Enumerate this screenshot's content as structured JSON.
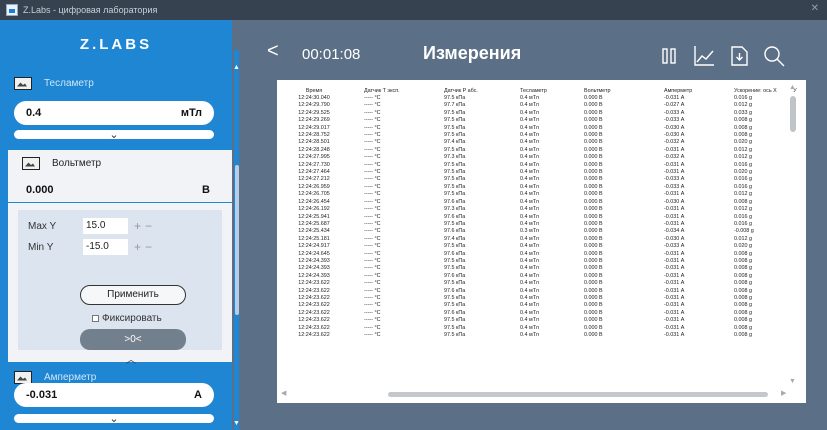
{
  "window": {
    "title": "Z.Labs - цифровая лаборатория"
  },
  "sidebar": {
    "logo": "Z.LABS",
    "teslameter": {
      "name": "Тесламетр",
      "value": "0.4",
      "unit": "мТл"
    },
    "voltmeter": {
      "name": "Вольтметр",
      "value": "0.000",
      "unit": "В",
      "max_y_label": "Max Y",
      "max_y_value": "15.0",
      "min_y_label": "Min Y",
      "min_y_value": "-15.0",
      "apply_label": "Применить",
      "fix_label": "Фиксировать",
      "zero_label": ">0<"
    },
    "ammeter": {
      "name": "Амперметр",
      "value": "-0.031",
      "unit": "А"
    }
  },
  "header": {
    "back_glyph": "<",
    "timer": "00:01:08",
    "title": "Измерения"
  },
  "table": {
    "columns": [
      "Время",
      "Датчик T эксп.",
      "Датчик P абс.",
      "Тесламетр",
      "Вольтметр",
      "Амперметр",
      "Ускорение: ось X",
      "У"
    ],
    "rows": [
      [
        "12:24:30.040",
        "----- °C",
        "97.5 кПа",
        "0.4 мТл",
        "0.000 В",
        "-0.031 А",
        "0.016 g",
        ""
      ],
      [
        "12:24:29.790",
        "----- °C",
        "97.7 кПа",
        "0.4 мТл",
        "0.000 В",
        "-0.027 А",
        "0.012 g",
        ""
      ],
      [
        "12:24:29.525",
        "----- °C",
        "97.5 кПа",
        "0.4 мТл",
        "0.000 В",
        "-0.033 А",
        "0.033 g",
        ""
      ],
      [
        "12:24:29.269",
        "----- °C",
        "97.5 кПа",
        "0.4 мТл",
        "0.000 В",
        "-0.033 А",
        "0.008 g",
        ""
      ],
      [
        "12:24:29.017",
        "----- °C",
        "97.5 кПа",
        "0.4 мТл",
        "0.000 В",
        "-0.030 А",
        "0.008 g",
        ""
      ],
      [
        "12:24:28.752",
        "----- °C",
        "97.5 кПа",
        "0.4 мТл",
        "0.000 В",
        "-0.030 А",
        "0.008 g",
        ""
      ],
      [
        "12:24:28.501",
        "----- °C",
        "97.4 кПа",
        "0.4 мТл",
        "0.000 В",
        "-0.032 А",
        "0.020 g",
        ""
      ],
      [
        "12:24:28.248",
        "----- °C",
        "97.5 кПа",
        "0.4 мТл",
        "0.000 В",
        "-0.031 А",
        "0.012 g",
        ""
      ],
      [
        "12:24:27.995",
        "----- °C",
        "97.3 кПа",
        "0.4 мТл",
        "0.000 В",
        "-0.032 А",
        "0.012 g",
        ""
      ],
      [
        "12:24:27.730",
        "----- °C",
        "97.5 кПа",
        "0.4 мТл",
        "0.000 В",
        "-0.031 А",
        "0.016 g",
        ""
      ],
      [
        "12:24:27.464",
        "----- °C",
        "97.5 кПа",
        "0.4 мТл",
        "0.000 В",
        "-0.031 А",
        "0.020 g",
        ""
      ],
      [
        "12:24:27.212",
        "----- °C",
        "97.5 кПа",
        "0.4 мТл",
        "0.000 В",
        "-0.033 А",
        "0.016 g",
        ""
      ],
      [
        "12:24:26.959",
        "----- °C",
        "97.5 кПа",
        "0.4 мТл",
        "0.000 В",
        "-0.033 А",
        "0.016 g",
        ""
      ],
      [
        "12:24:26.705",
        "----- °C",
        "97.5 кПа",
        "0.4 мТл",
        "0.000 В",
        "-0.031 А",
        "0.012 g",
        ""
      ],
      [
        "12:24:26.454",
        "----- °C",
        "97.6 кПа",
        "0.4 мТл",
        "0.000 В",
        "-0.030 А",
        "0.008 g",
        ""
      ],
      [
        "12:24:26.192",
        "----- °C",
        "97.3 кПа",
        "0.4 мТл",
        "0.000 В",
        "-0.031 А",
        "0.012 g",
        ""
      ],
      [
        "12:24:25.941",
        "----- °C",
        "97.6 кПа",
        "0.4 мТл",
        "0.000 В",
        "-0.031 А",
        "0.016 g",
        ""
      ],
      [
        "12:24:25.687",
        "----- °C",
        "97.5 кПа",
        "0.4 мТл",
        "0.000 В",
        "-0.031 А",
        "0.016 g",
        ""
      ],
      [
        "12:24:25.434",
        "----- °C",
        "97.6 кПа",
        "0.3 мТл",
        "0.000 В",
        "-0.034 А",
        "-0.008 g",
        ""
      ],
      [
        "12:24:25.181",
        "----- °C",
        "97.4 кПа",
        "0.4 мТл",
        "0.000 В",
        "-0.030 А",
        "0.012 g",
        ""
      ],
      [
        "12:24:24.917",
        "----- °C",
        "97.5 кПа",
        "0.4 мТл",
        "0.000 В",
        "-0.033 А",
        "0.020 g",
        ""
      ],
      [
        "12:24:24.645",
        "----- °C",
        "97.6 кПа",
        "0.4 мТл",
        "0.000 В",
        "-0.031 А",
        "0.008 g",
        ""
      ],
      [
        "12:24:24.393",
        "----- °C",
        "97.5 кПа",
        "0.4 мТл",
        "0.000 В",
        "-0.031 А",
        "0.008 g",
        ""
      ],
      [
        "12:24:24.393",
        "----- °C",
        "97.5 кПа",
        "0.4 мТл",
        "0.000 В",
        "-0.031 А",
        "0.008 g",
        ""
      ],
      [
        "12:24:24.393",
        "----- °C",
        "97.6 кПа",
        "0.4 мТл",
        "0.000 В",
        "-0.031 А",
        "0.008 g",
        ""
      ],
      [
        "12:24:23.622",
        "----- °C",
        "97.5 кПа",
        "0.4 мТл",
        "0.000 В",
        "-0.031 А",
        "0.008 g",
        ""
      ],
      [
        "12:24:23.622",
        "----- °C",
        "97.6 кПа",
        "0.4 мТл",
        "0.000 В",
        "-0.031 А",
        "0.008 g",
        ""
      ],
      [
        "12:24:23.622",
        "----- °C",
        "97.5 кПа",
        "0.4 мТл",
        "0.000 В",
        "-0.031 А",
        "0.008 g",
        ""
      ],
      [
        "12:24:23.622",
        "----- °C",
        "97.5 кПа",
        "0.4 мТл",
        "0.000 В",
        "-0.031 А",
        "0.008 g",
        ""
      ],
      [
        "12:24:23.622",
        "----- °C",
        "97.6 кПа",
        "0.4 мТл",
        "0.000 В",
        "-0.031 А",
        "0.008 g",
        ""
      ],
      [
        "12:24:23.622",
        "----- °C",
        "97.5 кПа",
        "0.4 мТл",
        "0.000 В",
        "-0.031 А",
        "0.008 g",
        ""
      ],
      [
        "12:24:23.622",
        "----- °C",
        "97.5 кПа",
        "0.4 мТл",
        "0.000 В",
        "-0.031 А",
        "0.008 g",
        ""
      ],
      [
        "12:24:23.622",
        "----- °C",
        "97.5 кПа",
        "0.4 мТл",
        "0.000 В",
        "-0.031 А",
        "0.008 g",
        ""
      ]
    ]
  },
  "icons": {
    "header": [
      "pause-icon",
      "graph-icon",
      "export-icon",
      "search-icon"
    ]
  },
  "colors": {
    "sidebar": "#1e86d2",
    "background": "#5b6f86",
    "button_dark": "#727f8c"
  }
}
